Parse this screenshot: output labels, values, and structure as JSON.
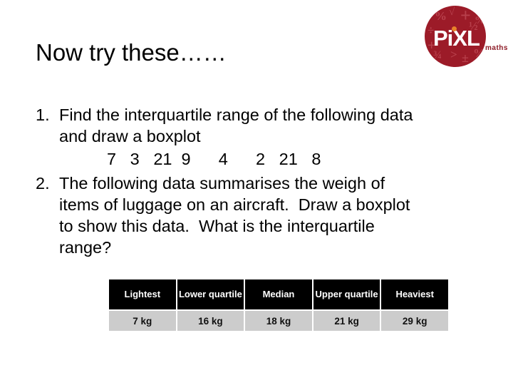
{
  "logo": {
    "name": "pixl-maths-logo",
    "wordmark_pi": "Pi",
    "wordmark_xl": "XL",
    "sub_label": "maths",
    "circle_color": "#9c1b28",
    "symbol_color": "#b8404c",
    "dot_color": "#e8832a",
    "symbols": [
      "%",
      "√",
      "+",
      "½",
      "÷",
      "·",
      "+",
      "¾",
      ">",
      "±",
      "%",
      "%"
    ]
  },
  "slide": {
    "title": "Now try these……"
  },
  "questions": [
    {
      "number": "1.",
      "lines": [
        "Find the interquartile range of the following data",
        "and draw a boxplot"
      ]
    },
    {
      "number": "2.",
      "lines": [
        "The following data summarises the weigh of",
        "items of luggage on an aircraft.  Draw a boxplot",
        "to show this data.  What is the interquartile",
        "range?"
      ]
    }
  ],
  "data_set": {
    "label": "7   3   21  9      4      2   21   8",
    "values": [
      7,
      3,
      21,
      9,
      4,
      2,
      21,
      8
    ]
  },
  "summary_table": {
    "headers": [
      "Lightest",
      "Lower quartile",
      "Median",
      "Upper quartile",
      "Heaviest"
    ],
    "values": [
      "7 kg",
      "16 kg",
      "18 kg",
      "21 kg",
      "29 kg"
    ],
    "header_bg": "#000000",
    "header_fg": "#ffffff",
    "cell_bg": "#cccccc"
  }
}
